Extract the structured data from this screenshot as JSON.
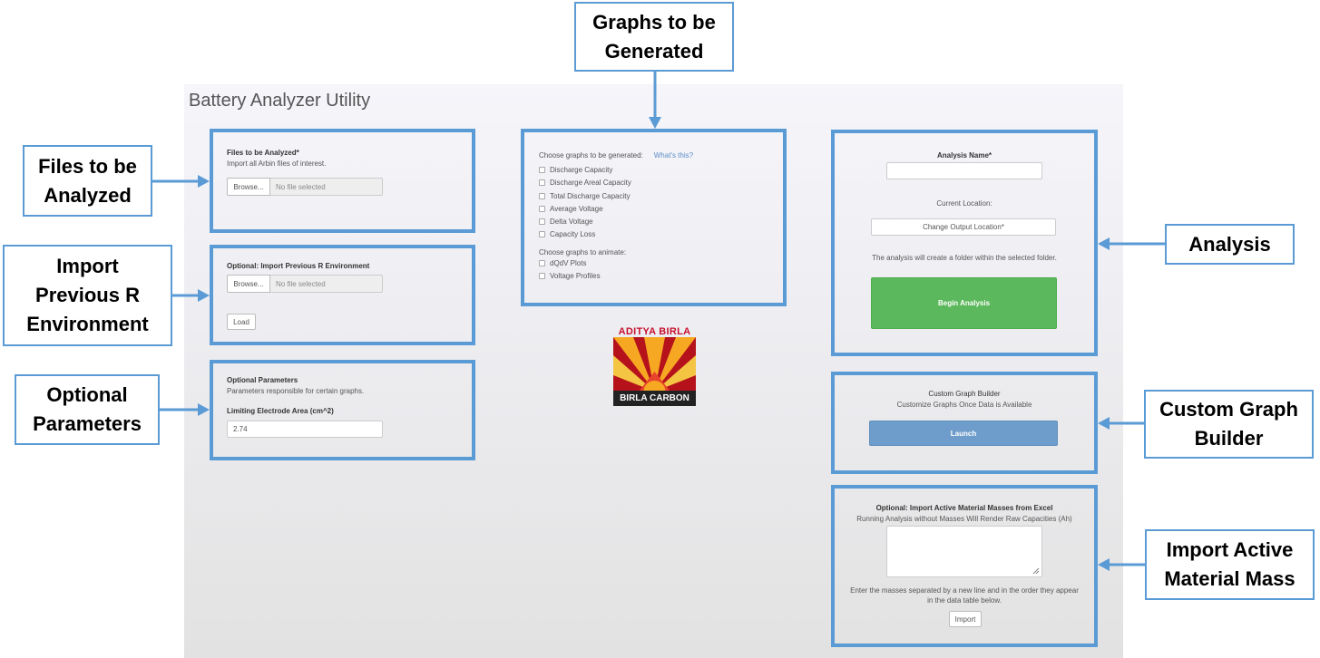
{
  "app": {
    "title": "Battery Analyzer Utility"
  },
  "files_panel": {
    "heading": "Files to be Analyzed*",
    "help": "Import all Arbin files of interest.",
    "browse_label": "Browse...",
    "file_placeholder": "No file selected"
  },
  "import_env_panel": {
    "heading": "Optional: Import Previous R Environment",
    "browse_label": "Browse...",
    "file_placeholder": "No file selected",
    "load_label": "Load"
  },
  "params_panel": {
    "heading": "Optional Parameters",
    "help": "Parameters responsible for certain graphs.",
    "field_label": "Limiting Electrode Area (cm^2)",
    "field_value": "2.74"
  },
  "graphs_panel": {
    "heading": "Choose graphs to be generated:",
    "help_link": "What's this?",
    "graphs": [
      "Discharge Capacity",
      "Discharge Areal Capacity",
      "Total Discharge Capacity",
      "Average Voltage",
      "Delta Voltage",
      "Capacity Loss"
    ],
    "animate_heading": "Choose graphs to animate:",
    "animations": [
      "dQdV Plots",
      "Voltage Profiles"
    ]
  },
  "logo": {
    "top_text": "ADITYA BIRLA",
    "bottom_text": "BIRLA CARBON"
  },
  "analysis_panel": {
    "name_label": "Analysis Name*",
    "name_value": "",
    "location_label": "Current Location:",
    "change_location_label": "Change Output Location*",
    "note": "The analysis will create a folder within the selected folder.",
    "begin_label": "Begin Analysis"
  },
  "graph_builder_panel": {
    "heading": "Custom Graph Builder",
    "subheading": "Customize Graphs Once Data is Available",
    "launch_label": "Launch"
  },
  "masses_panel": {
    "heading": "Optional: Import Active Material Masses from Excel",
    "subheading": "Running Analysis without Masses Will Render Raw Capacities (Ah)",
    "note_line1": "Enter the masses separated by a new line and in the order they appear",
    "note_line2": "in the data table below.",
    "import_label": "Import"
  },
  "callouts": {
    "graphs_line1": "Graphs to be",
    "graphs_line2": "Generated",
    "files_line1": "Files to be",
    "files_line2": "Analyzed",
    "import_line1": "Import",
    "import_line2": "Previous R",
    "import_line3": "Environment",
    "params_line1": "Optional",
    "params_line2": "Parameters",
    "analysis": "Analysis",
    "builder_line1": "Custom Graph",
    "builder_line2": "Builder",
    "masses_line1": "Import Active",
    "masses_line2": "Material Mass"
  },
  "colors": {
    "annotation_blue": "#5b9bd5",
    "begin_green": "#5cb85c",
    "launch_blue": "#6e9dcb",
    "logo_red": "#c8102e"
  }
}
